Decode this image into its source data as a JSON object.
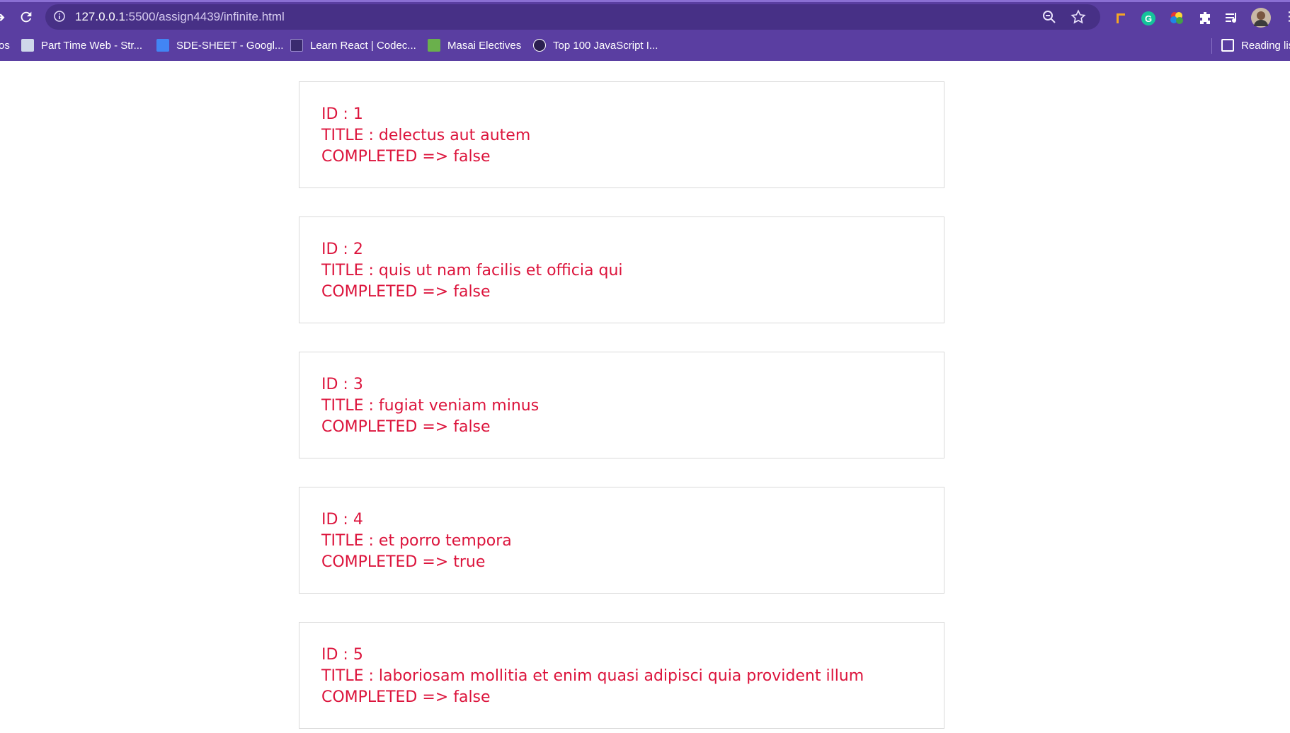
{
  "browser": {
    "url_host": "127.0.0.1",
    "url_rest": ":5500/assign4439/infinite.html",
    "bookmarks": [
      {
        "label": "Part Time Web - Str...",
        "icon": "book-icon"
      },
      {
        "label": "SDE-SHEET - Googl...",
        "icon": "google-docs-icon"
      },
      {
        "label": "Learn React | Codec...",
        "icon": "codecademy-icon"
      },
      {
        "label": "Masai Electives",
        "icon": "green-book-icon"
      },
      {
        "label": "Top 100 JavaScript I...",
        "icon": "github-icon"
      }
    ],
    "bookmarks_cutoff": "os",
    "reading_list": "Reading lis",
    "colors": {
      "chrome": "#5a3ea1",
      "omnibox": "#473086"
    }
  },
  "page": {
    "text_color": "#dc143c",
    "todos": [
      {
        "id": "ID : 1",
        "title": "TITLE : delectus aut autem",
        "completed": "COMPLETED => false"
      },
      {
        "id": "ID : 2",
        "title": "TITLE : quis ut nam facilis et officia qui",
        "completed": "COMPLETED => false"
      },
      {
        "id": "ID : 3",
        "title": "TITLE : fugiat veniam minus",
        "completed": "COMPLETED => false"
      },
      {
        "id": "ID : 4",
        "title": "TITLE : et porro tempora",
        "completed": "COMPLETED => true"
      },
      {
        "id": "ID : 5",
        "title": "TITLE : laboriosam mollitia et enim quasi adipisci quia provident illum",
        "completed": "COMPLETED => false"
      }
    ]
  }
}
